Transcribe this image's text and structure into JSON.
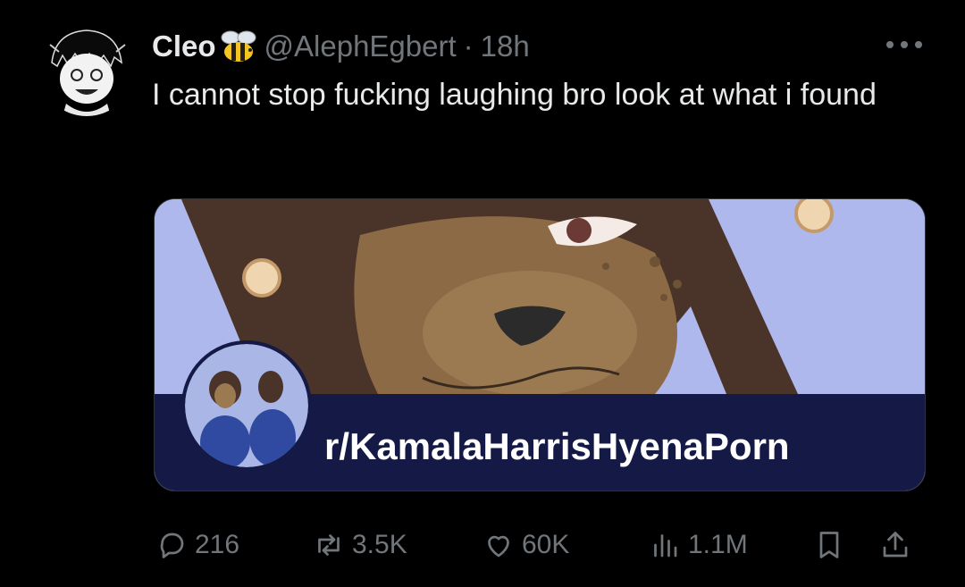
{
  "tweet": {
    "author_name": "Cleo",
    "handle": "@AlephEgbert",
    "separator": "·",
    "time": "18h",
    "text": "I cannot stop fucking laughing bro look at what i found",
    "name_badge_icon": "bee-icon",
    "more_icon": "more-icon"
  },
  "card": {
    "title": "r/KamalaHarrisHyenaPorn",
    "background_color": "#aeb8ec",
    "bar_color": "#141a45"
  },
  "actions": {
    "replies": "216",
    "reposts": "3.5K",
    "likes": "60K",
    "views": "1.1M",
    "icons": [
      "reply-icon",
      "repost-icon",
      "like-icon",
      "views-icon",
      "bookmark-icon",
      "share-icon"
    ]
  },
  "colors": {
    "background": "#000000",
    "text": "#e7e9ea",
    "muted": "#71767b"
  }
}
